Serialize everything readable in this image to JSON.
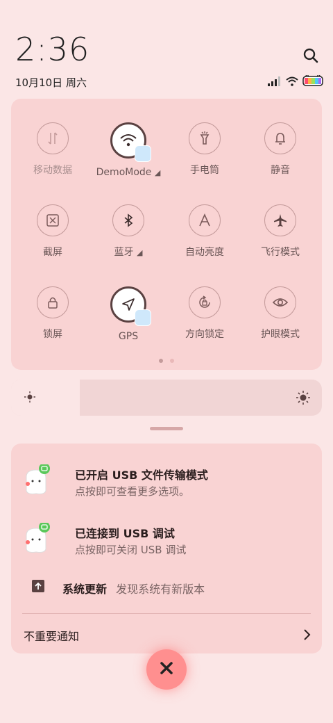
{
  "header": {
    "time": "2:36",
    "date": "10月10日 周六"
  },
  "icons": {
    "search": "search-icon",
    "signal": "signal-icon",
    "wifi": "wifi-icon",
    "battery": "battery-icon"
  },
  "quick_settings": {
    "tiles": [
      {
        "label": "移动数据",
        "icon": "mobile-data-icon",
        "state": "off"
      },
      {
        "label": "DemoMode",
        "icon": "wifi-icon",
        "state": "on"
      },
      {
        "label": "手电筒",
        "icon": "flashlight-icon",
        "state": "off"
      },
      {
        "label": "静音",
        "icon": "bell-icon",
        "state": "off"
      },
      {
        "label": "截屏",
        "icon": "screenshot-icon",
        "state": "off"
      },
      {
        "label": "蓝牙",
        "icon": "bluetooth-icon",
        "state": "off"
      },
      {
        "label": "自动亮度",
        "icon": "auto-brightness-icon",
        "state": "off"
      },
      {
        "label": "飞行模式",
        "icon": "airplane-icon",
        "state": "off"
      },
      {
        "label": "锁屏",
        "icon": "lock-icon",
        "state": "off"
      },
      {
        "label": "GPS",
        "icon": "location-icon",
        "state": "on"
      },
      {
        "label": "方向锁定",
        "icon": "rotation-lock-icon",
        "state": "off"
      },
      {
        "label": "护眼模式",
        "icon": "eye-icon",
        "state": "off"
      }
    ],
    "page_count": 2,
    "current_page": 1
  },
  "brightness": {
    "level": 0.22
  },
  "notifications": [
    {
      "title": "已开启 USB 文件传输模式",
      "subtitle": "点按即可查看更多选项。"
    },
    {
      "title": "已连接到 USB 调试",
      "subtitle": "点按即可关闭 USB 调试"
    },
    {
      "title": "系统更新",
      "subtitle": "发现系统有新版本"
    }
  ],
  "less_important": "不重要通知",
  "colors": {
    "background": "#fbe6e6",
    "panel": "#f9d3d3",
    "clear_button": "#ff8f8f"
  }
}
